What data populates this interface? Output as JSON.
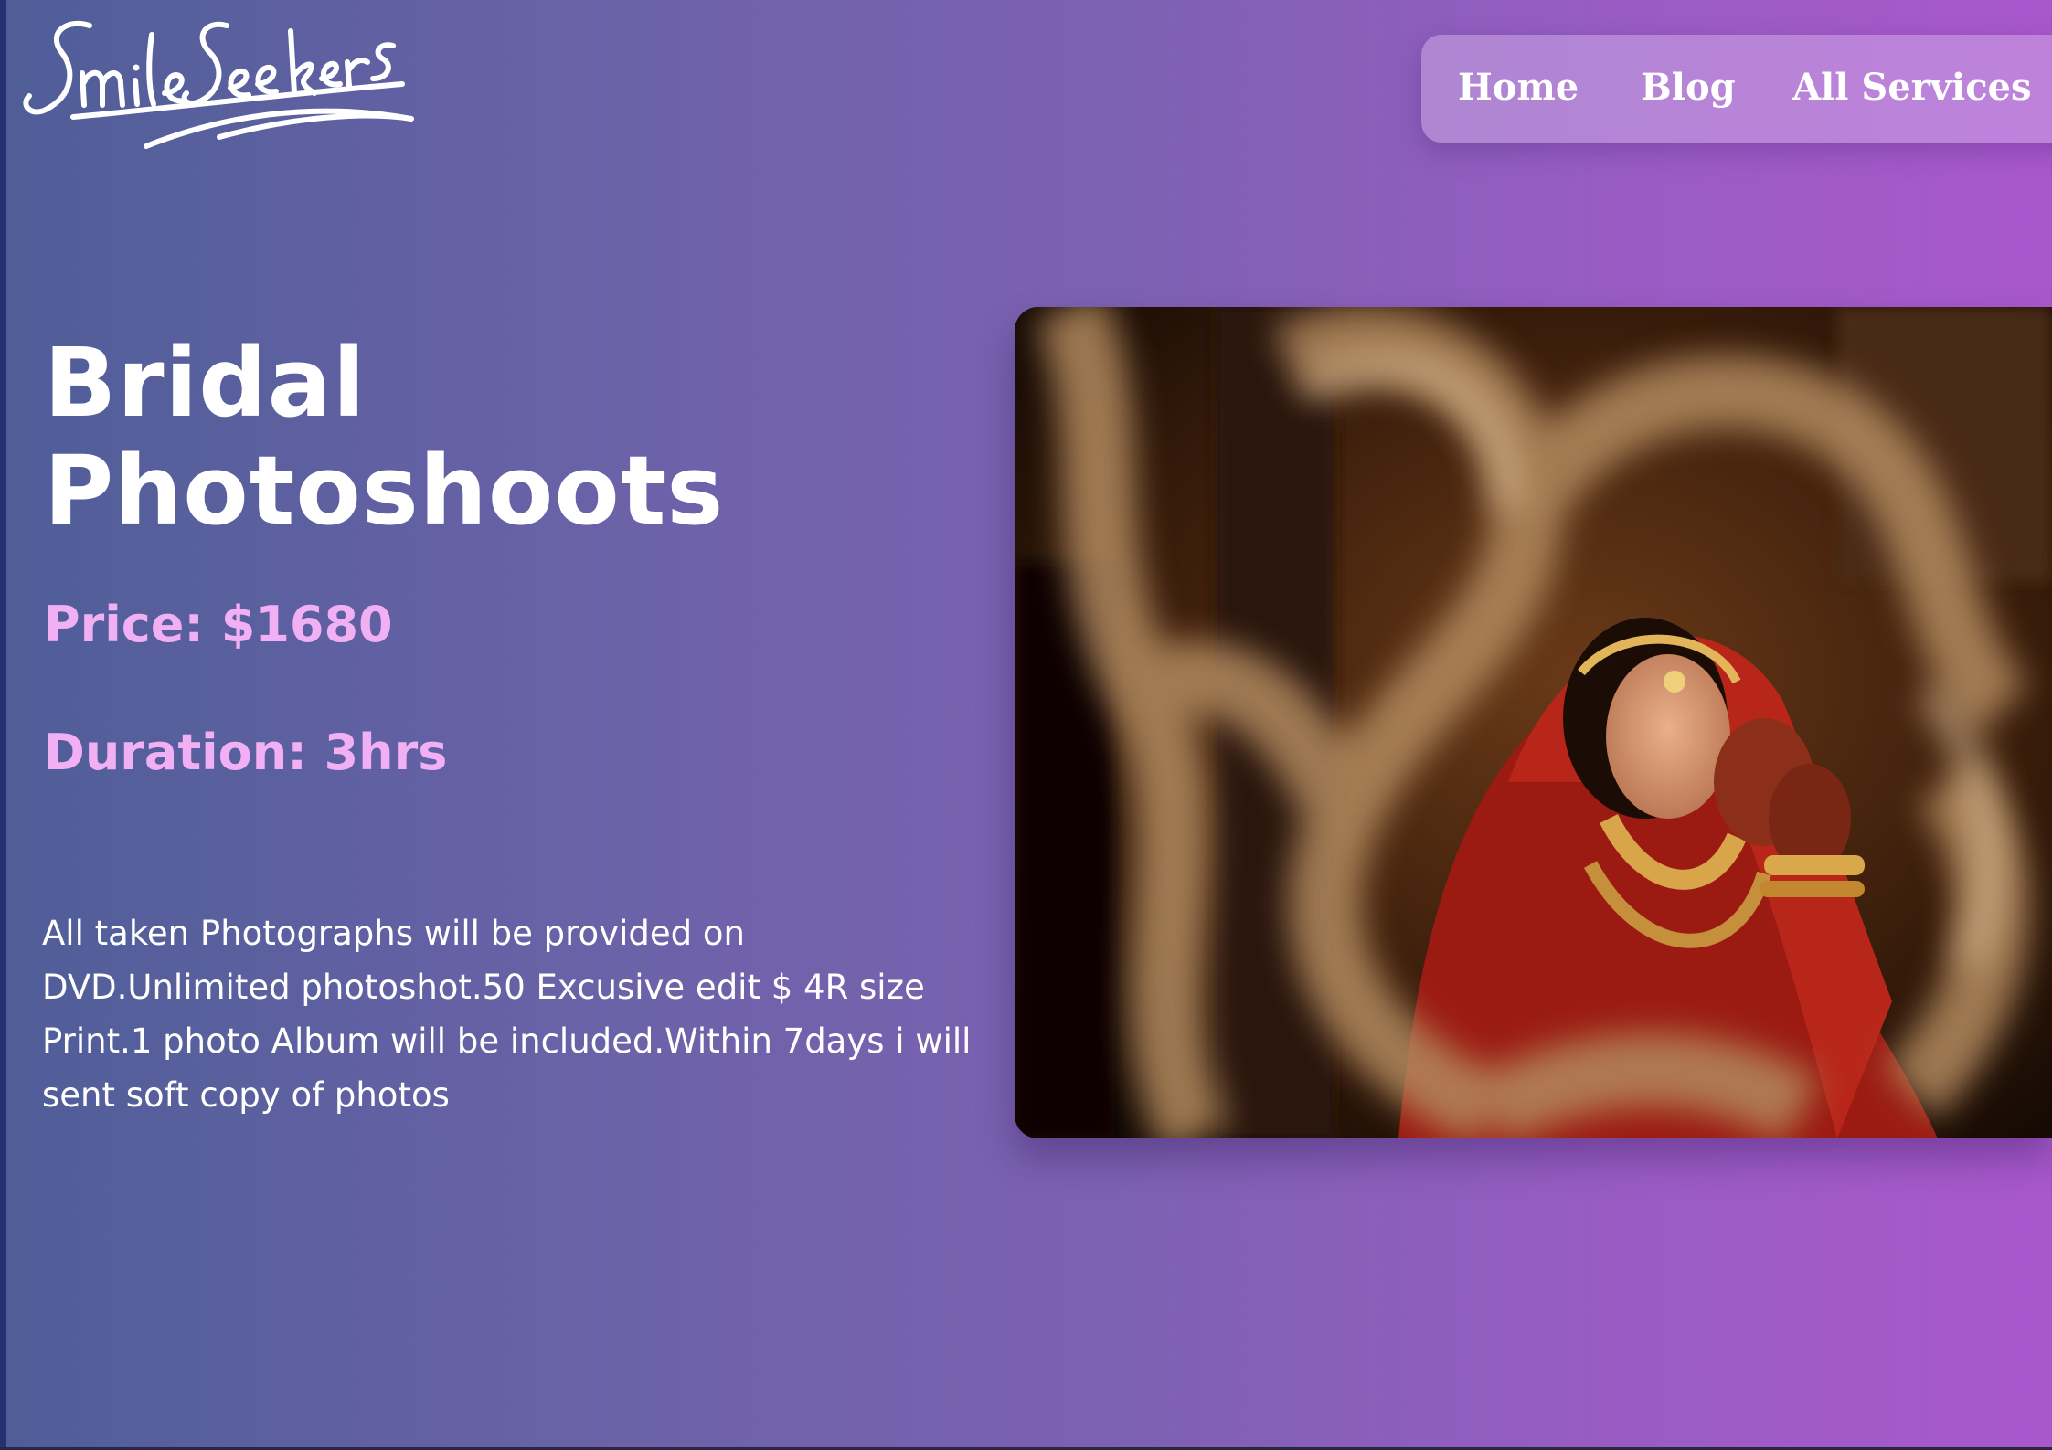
{
  "logo": {
    "text": "SmileSeekers"
  },
  "nav": {
    "items": [
      {
        "label": "Home"
      },
      {
        "label": "Blog"
      },
      {
        "label": "All Services"
      }
    ]
  },
  "service": {
    "title": "Bridal Photoshoots",
    "price": "Price: $1680",
    "duration": "Duration: 3hrs",
    "description": "All taken Photographs will be provided on DVD.Unlimited photoshot.50 Excusive edit $ 4R size Print.1 photo Album will be included.Within 7days i will sent soft copy of photos"
  },
  "colors": {
    "gradient_start": "#4f5e98",
    "gradient_end": "#a958cc",
    "accent_text": "#f2b0f4"
  }
}
